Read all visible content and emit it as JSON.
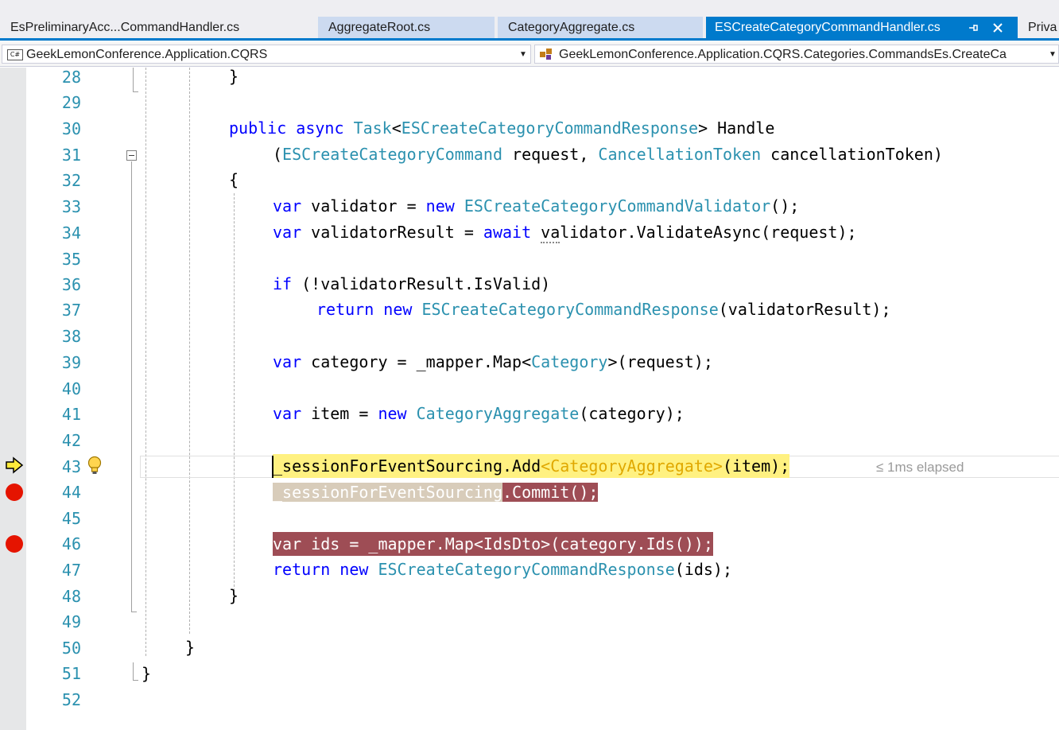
{
  "tabs": [
    {
      "label": "EsPreliminaryAcc...CommandHandler.cs",
      "state": "plain"
    },
    {
      "label": "AggregateRoot.cs",
      "state": "inactive"
    },
    {
      "label": "CategoryAggregate.cs",
      "state": "inactive"
    },
    {
      "label": "ESCreateCategoryCommandHandler.cs",
      "state": "active"
    },
    {
      "label": "Priva",
      "state": "plain"
    }
  ],
  "tab_icons": {
    "pin": "pin-icon",
    "close": "close-icon"
  },
  "navbar": {
    "project_badge": "C#",
    "project": "GeekLemonConference.Application.CQRS",
    "member": "GeekLemonConference.Application.CQRS.Categories.CommandsEs.CreateCa"
  },
  "editor": {
    "line_numbers": [
      "28",
      "29",
      "30",
      "31",
      "32",
      "33",
      "34",
      "35",
      "36",
      "37",
      "38",
      "39",
      "40",
      "41",
      "42",
      "43",
      "44",
      "45",
      "46",
      "47",
      "48",
      "49",
      "50",
      "51",
      "52"
    ],
    "code": {
      "l28": "}",
      "l30_public": "public",
      "l30_async": "async",
      "l30_task": "Task",
      "l30_lt": "<",
      "l30_resp": "ESCreateCategoryCommandResponse",
      "l30_rest": "> Handle",
      "l31_open": "(",
      "l31_cmd": "ESCreateCategoryCommand",
      "l31_mid": " request, ",
      "l31_ct": "CancellationToken",
      "l31_rest": " cancellationToken)",
      "l32": "{",
      "l33_var": "var",
      "l33_mid": " validator = ",
      "l33_new": "new",
      "l33_type": "ESCreateCategoryCommandValidator",
      "l33_rest": "();",
      "l34_var": "var",
      "l34_mid": " validatorResult = ",
      "l34_await": "await",
      "l34_dotted": "va",
      "l34_rest": "lidator.ValidateAsync(request);",
      "l36_if": "if",
      "l36_rest": " (!validatorResult.IsValid)",
      "l37_return": "return",
      "l37_new": "new",
      "l37_type": "ESCreateCategoryCommandResponse",
      "l37_rest": "(validatorResult);",
      "l39_var": "var",
      "l39_mid": " category = _mapper.Map<",
      "l39_type": "Category",
      "l39_rest": ">(request);",
      "l41_var": "var",
      "l41_mid": " item = ",
      "l41_new": "new",
      "l41_type": "CategoryAggregate",
      "l41_rest": "(category);",
      "l43_a": "_sessionForEventSourcing",
      "l43_b": ".Add",
      "l43_type": "<CategoryAggregate>",
      "l43_c": "(item);",
      "l44_a": "_sessionForEventSourcing",
      "l44_b": ".Commit();",
      "l46": "var ids = _mapper.Map<IdsDto>(category.Ids());",
      "l47_return": "return",
      "l47_new": "new",
      "l47_type": "ESCreateCategoryCommandResponse",
      "l47_rest": "(ids);",
      "l48": "}",
      "l50": "}",
      "l51": "}"
    },
    "elapsed": "≤ 1ms elapsed",
    "glyph_icons": {
      "breakpoint": "breakpoint-icon",
      "execution": "current-statement-arrow-icon",
      "bulb": "lightbulb-icon"
    }
  },
  "colors": {
    "active_tab": "#007acc",
    "inactive_tab": "#ccdaf0",
    "keyword": "#0000ff",
    "type": "#2b91af",
    "current_statement": "#fff181",
    "breakpoint_line": "#9e4d55",
    "breakpoint": "#e51400"
  }
}
